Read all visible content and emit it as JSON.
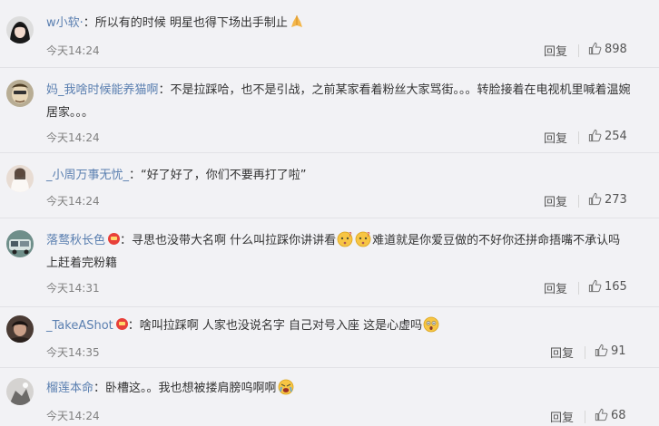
{
  "comments": [
    {
      "username": "w小软·",
      "text_parts": [
        "：所以有的时候 明星也得下场出手制止"
      ],
      "emojis": [
        "folded-hands-emoji"
      ],
      "time": "今天14:24",
      "reply": "回复",
      "likes": "898"
    },
    {
      "username": "妈_我啥时候能养猫啊",
      "text": "：不是拉踩哈，也不是引战，之前某家看着粉丝大家骂街。。。转脸接着在电视机里喊着温婉居家。。。",
      "time": "今天14:24",
      "reply": "回复",
      "likes": "254"
    },
    {
      "username": "_小周万事无忧_",
      "text": "：“好了好了，你们不要再打了啦”",
      "time": "今天14:24",
      "reply": "回复",
      "likes": "273"
    },
    {
      "username": "落鹜秋长色",
      "text_a": "：寻思也没带大名啊 什么叫拉踩你讲讲看",
      "text_b": "难道就是你爱豆做的不好你还拼命捂嘴不承认吗 上赶着完粉籍",
      "emojis": [
        "question-face-emoji",
        "question-face-emoji"
      ],
      "time": "今天14:31",
      "reply": "回复",
      "likes": "165"
    },
    {
      "username": "_TakeAShot",
      "text": "：啥叫拉踩啊 人家也没说名字 自己对号入座 这是心虚吗",
      "emojis": [
        "shocked-face-emoji"
      ],
      "time": "今天14:35",
      "reply": "回复",
      "likes": "91"
    },
    {
      "username": "榴莲本命",
      "text": "：卧槽这。。我也想被搂肩膀呜啊啊",
      "emojis": [
        "crying-face-emoji"
      ],
      "time": "今天14:24",
      "reply": "回复",
      "likes": "68"
    }
  ],
  "colors": {
    "username": "#5a7fb0",
    "background": "#f2f2f5",
    "timestamp": "#808080",
    "badge": "#e8403a"
  },
  "icons": {
    "like": "thumbs-up-icon",
    "vip_badge": "crown-badge-icon"
  }
}
